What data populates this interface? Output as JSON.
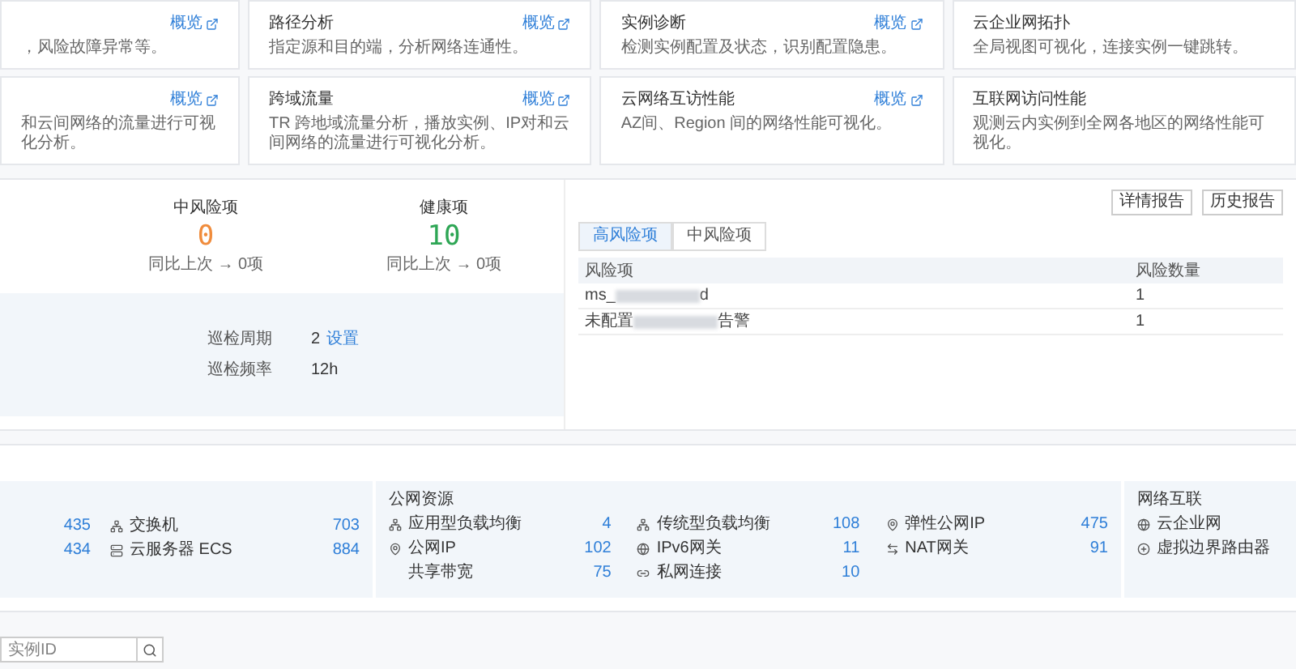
{
  "feature_cards": [
    {
      "description": "，风险故障异常等。",
      "link": "概览"
    },
    {
      "title": "路径分析",
      "description": "指定源和目的端，分析网络连通性。",
      "link": "概览"
    },
    {
      "title": "实例诊断",
      "description": "检测实例配置及状态，识别配置隐患。",
      "link": "概览"
    },
    {
      "title": "云企业网拓扑",
      "description": "全局视图可视化，连接实例一键跳转。"
    },
    {
      "description": "和云间网络的流量进行可视化分析。",
      "link": "概览"
    },
    {
      "title": "跨域流量",
      "description": "TR 跨地域流量分析，播放实例、IP对和云间网络的流量进行可视化分析。",
      "link": "概览"
    },
    {
      "title": "云网络互访性能",
      "description": "AZ间、Region 间的网络性能可视化。",
      "link": "概览"
    },
    {
      "title": "互联网访问性能",
      "description": "观测云内实例到全网各地区的网络性能可视化。"
    }
  ],
  "inspection": {
    "stats": [
      {
        "label": "中风险项",
        "value": "0",
        "color": "#f08c3c",
        "compare": "同比上次 → 0项"
      },
      {
        "label": "健康项",
        "value": "10",
        "color": "#2ea655",
        "compare": "同比上次 → 0项"
      }
    ],
    "settings": [
      {
        "label": "巡检周期",
        "value": "2",
        "link": "设置"
      },
      {
        "label": "巡检频率",
        "value": "12h"
      }
    ],
    "buttons": [
      "详情报告",
      "历史报告"
    ],
    "tabs": [
      {
        "label": "高风险项",
        "selected": true
      },
      {
        "label": "中风险项",
        "selected": false
      }
    ],
    "table": {
      "columns": [
        "风险项",
        "风险数量"
      ],
      "rows": [
        {
          "name_start": "ms_",
          "name_end": "d",
          "count": "1"
        },
        {
          "name_start": "未配置",
          "name_end": "告警",
          "count": "1"
        }
      ]
    }
  },
  "resources": {
    "cut_counts": [
      "435",
      "434"
    ],
    "columns": [
      {
        "items": [
          {
            "kind": "switch",
            "label": "交换机",
            "count": "703"
          },
          {
            "kind": "server",
            "label": "云服务器 ECS",
            "count": "884"
          }
        ]
      }
    ],
    "groups": [
      {
        "title": "公网资源",
        "columns": [
          {
            "items": [
              {
                "kind": "balancer",
                "label": "应用型负载均衡",
                "count": "4"
              },
              {
                "kind": "ip",
                "label": "公网IP",
                "count": "102"
              },
              {
                "kind": "plain",
                "label": "共享带宽",
                "count": "75"
              }
            ]
          },
          {
            "items": [
              {
                "kind": "balancer",
                "label": "传统型负载均衡",
                "count": "108"
              },
              {
                "kind": "globe",
                "label": "IPv6网关",
                "count": "11"
              },
              {
                "kind": "link",
                "label": "私网连接",
                "count": "10"
              }
            ]
          },
          {
            "items": [
              {
                "kind": "ip",
                "label": "弹性公网IP",
                "count": "475"
              },
              {
                "kind": "nat",
                "label": "NAT网关",
                "count": "91"
              }
            ]
          }
        ]
      },
      {
        "title": "网络互联",
        "columns": [
          {
            "items": [
              {
                "kind": "globe",
                "label": "云企业网"
              },
              {
                "kind": "router",
                "label": "虚拟边界路由器"
              }
            ]
          }
        ]
      }
    ]
  },
  "search": {
    "placeholder": "实例ID"
  }
}
